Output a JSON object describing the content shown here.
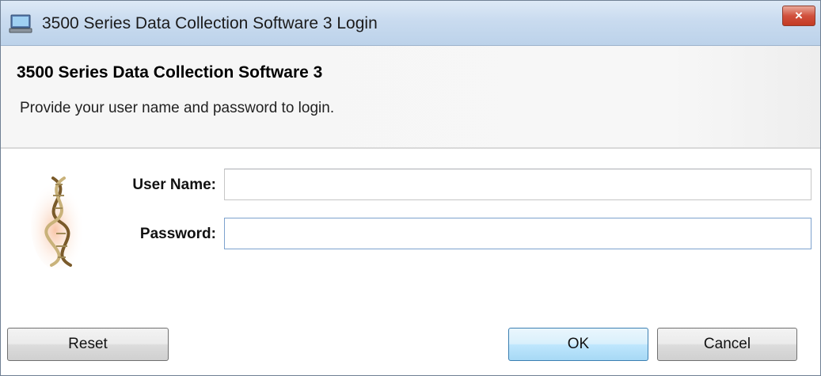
{
  "window": {
    "title": "3500 Series Data Collection Software 3 Login",
    "close_label": "×",
    "app_icon": "computer-monitor-icon"
  },
  "header": {
    "heading": "3500 Series Data Collection Software 3",
    "subheading": "Provide your user name and password to login."
  },
  "form": {
    "logo_icon": "dna-helix-icon",
    "username_label": "User Name:",
    "username_value": "",
    "password_label": "Password:",
    "password_value": ""
  },
  "buttons": {
    "reset": "Reset",
    "ok": "OK",
    "cancel": "Cancel"
  },
  "colors": {
    "titlebar": "#c9dbef",
    "close_button": "#d1513d",
    "default_button_border": "#3c7fb1",
    "focus_border": "#7da2ce"
  }
}
